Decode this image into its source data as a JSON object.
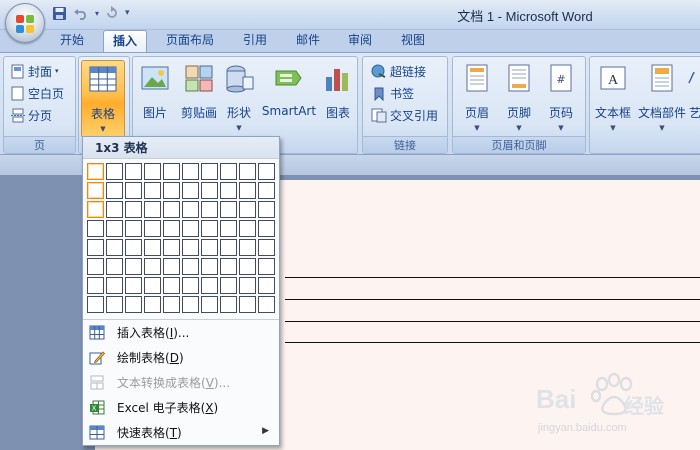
{
  "title": "文档 1 - Microsoft Word",
  "quick_access": [
    "save-icon",
    "undo-icon",
    "redo-icon",
    "customize-icon"
  ],
  "tabs": [
    {
      "label": "开始",
      "active": false
    },
    {
      "label": "插入",
      "active": true
    },
    {
      "label": "页面布局",
      "active": false
    },
    {
      "label": "引用",
      "active": false
    },
    {
      "label": "邮件",
      "active": false
    },
    {
      "label": "审阅",
      "active": false
    },
    {
      "label": "视图",
      "active": false
    }
  ],
  "ribbon": {
    "pages_group": {
      "label": "页",
      "cover": "封面",
      "blank": "空白页",
      "break": "分页"
    },
    "table_button": "表格",
    "illustrations": {
      "picture": "图片",
      "clipart": "剪贴画",
      "shapes": "形状",
      "smartart": "SmartArt",
      "chart": "图表"
    },
    "links_group": {
      "label": "链接",
      "hyperlink": "超链接",
      "bookmark": "书签",
      "crossref": "交叉引用"
    },
    "header_footer_group": {
      "label": "页眉和页脚",
      "header": "页眉",
      "footer": "页脚",
      "page_number": "页码"
    },
    "text_group": {
      "textbox": "文本框",
      "quickparts": "文档部件",
      "wordart": "艺"
    }
  },
  "dropdown": {
    "header": "1x3 表格",
    "grid": {
      "rows": 8,
      "cols": 10,
      "selected_rows": 3,
      "selected_cols": 1
    },
    "items": [
      {
        "label": "插入表格(",
        "key": "I",
        "suffix": ")...",
        "disabled": false,
        "icon": "insert-table-icon"
      },
      {
        "label": "绘制表格(",
        "key": "D",
        "suffix": ")",
        "disabled": false,
        "icon": "draw-table-icon"
      },
      {
        "label": "文本转换成表格(",
        "key": "V",
        "suffix": ")...",
        "disabled": true,
        "icon": "text-to-table-icon"
      },
      {
        "label": "Excel 电子表格(",
        "key": "X",
        "suffix": ")",
        "disabled": false,
        "icon": "excel-icon"
      },
      {
        "label": "快速表格(",
        "key": "T",
        "suffix": ")",
        "disabled": false,
        "icon": "quick-table-icon",
        "submenu": true
      }
    ]
  },
  "watermark": {
    "brand": "Bai",
    "brand2": "经验",
    "url": "jingyan.baidu.com"
  }
}
